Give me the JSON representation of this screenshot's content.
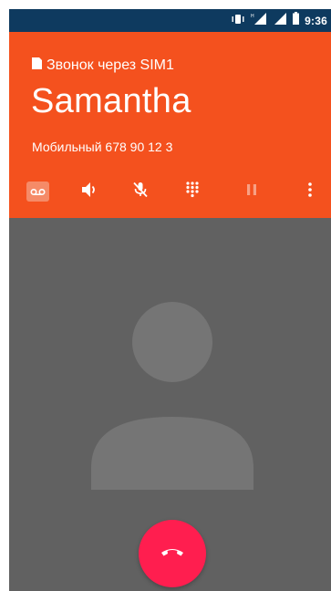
{
  "status_bar": {
    "time": "9:36",
    "icons": [
      "vibrate-icon",
      "signal-icon",
      "signal-icon",
      "battery-icon"
    ]
  },
  "call": {
    "sim_label": "Звонок через SIM1",
    "caller_name": "Samantha",
    "caller_number": "Мобильный 678 90 12 3"
  },
  "actions": [
    {
      "name": "voicemail-icon",
      "active": true
    },
    {
      "name": "speaker-icon",
      "active": true
    },
    {
      "name": "mute-icon",
      "active": true
    },
    {
      "name": "dialpad-icon",
      "active": true
    },
    {
      "name": "hold-icon",
      "active": false
    },
    {
      "name": "more-icon",
      "active": true
    }
  ],
  "end_call": {
    "icon": "hangup-icon"
  },
  "colors": {
    "status_bar": "#0e3a5f",
    "header": "#f4511e",
    "body": "#616161",
    "avatar": "#757575",
    "end_call": "#ff1e4f"
  }
}
